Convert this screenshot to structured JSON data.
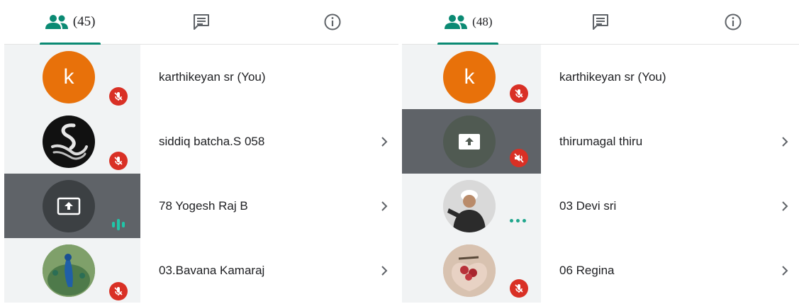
{
  "left_panel": {
    "tabs": {
      "people_count": "(45)",
      "chat_icon": "chat-icon",
      "info_icon": "info-icon"
    },
    "participants": [
      {
        "name": "karthikeyan sr (You)",
        "avatar": "k",
        "mic": "muted"
      },
      {
        "name": "siddiq batcha.S 058",
        "avatar": "swan-logo",
        "mic": "muted"
      },
      {
        "name": "78 Yogesh Raj B",
        "avatar": "present-screen",
        "mic": "speaking"
      },
      {
        "name": "03.Bavana Kamaraj",
        "avatar": "peacock-photo",
        "mic": "muted"
      }
    ]
  },
  "right_panel": {
    "tabs": {
      "people_count": "(48)",
      "chat_icon": "chat-icon",
      "info_icon": "info-icon"
    },
    "participants": [
      {
        "name": "karthikeyan sr (You)",
        "avatar": "k",
        "mic": "muted"
      },
      {
        "name": "thirumagal thiru",
        "avatar": "present-screen",
        "mic": "audio-off"
      },
      {
        "name": "03 Devi sri",
        "avatar": "man-photo",
        "mic": "dots"
      },
      {
        "name": "06 Regina",
        "avatar": "roses-photo",
        "mic": "muted"
      }
    ]
  },
  "colors": {
    "accent": "#0b8a73",
    "muted_badge": "#d93025",
    "avatar_orange": "#e8710a",
    "presenting_row": "#5f6368",
    "speaking": "#1fc6a8"
  }
}
